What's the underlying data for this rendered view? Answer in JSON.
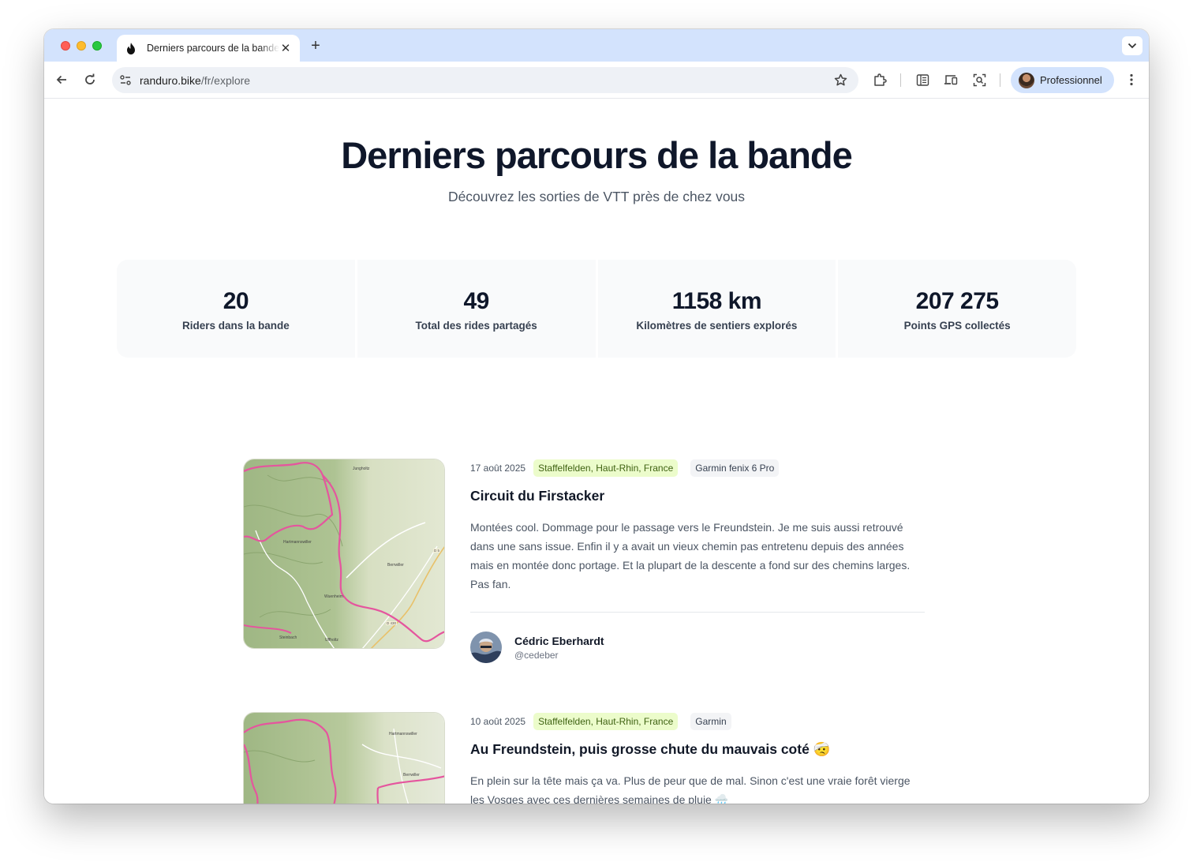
{
  "browser": {
    "tab_title": "Derniers parcours de la bande",
    "url_host": "randuro.bike",
    "url_path": "/fr/explore",
    "profile_name": "Professionnel"
  },
  "hero": {
    "title": "Derniers parcours de la bande",
    "subtitle": "Découvrez les sorties de VTT près de chez vous"
  },
  "stats": [
    {
      "value": "20",
      "label": "Riders dans la bande"
    },
    {
      "value": "49",
      "label": "Total des rides partagés"
    },
    {
      "value": "1158 km",
      "label": "Kilomètres de sentiers explorés"
    },
    {
      "value": "207 275",
      "label": "Points GPS collectés"
    }
  ],
  "rides": [
    {
      "date": "17 août 2025",
      "location": "Staffelfelden, Haut-Rhin, France",
      "device": "Garmin fenix 6 Pro",
      "title": "Circuit du Firstacker",
      "description": "Montées cool. Dommage pour le passage vers le Freundstein. Je me suis aussi retrouvé dans une sans issue. Enfin il y a avait un vieux chemin pas entretenu depuis des années mais en montée donc portage. Et la plupart de la descente a fond sur des chemins larges. Pas fan.",
      "author_name": "Cédric Eberhardt",
      "author_handle": "@cedeber",
      "map_labels": [
        "Jungholtz",
        "Hartmannswiller",
        "Berrwiller",
        "Wuenheim",
        "Steinbach",
        "Uffholtz",
        "D 430",
        "D 5"
      ]
    },
    {
      "date": "10 août 2025",
      "location": "Staffelfelden, Haut-Rhin, France",
      "device": "Garmin",
      "title": "Au Freundstein, puis grosse chute du mauvais coté 🤕",
      "description": "En plein sur la tête mais ça va. Plus de peur que de mal. Sinon c'est une vraie forêt vierge les Vosges avec ces dernières semaines de pluie 🌧️",
      "map_labels": [
        "Hartmannswiller",
        "Berrwiller"
      ]
    }
  ],
  "colors": {
    "route": "#e5559e",
    "accent_green_bg": "#ecfccb",
    "accent_green_text": "#3f6212"
  }
}
